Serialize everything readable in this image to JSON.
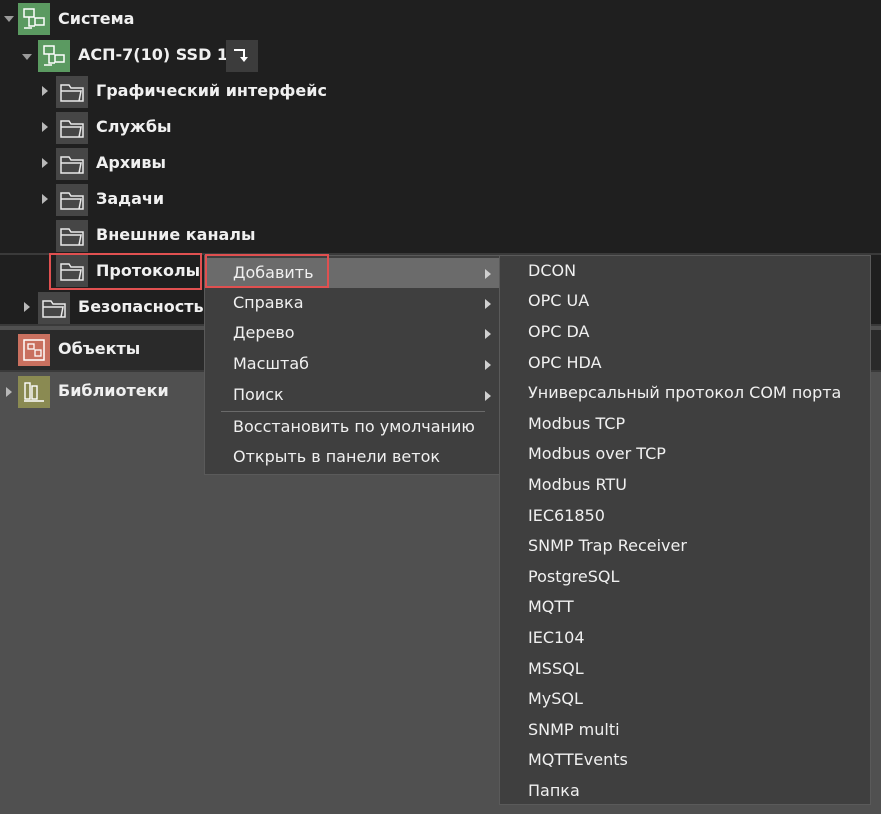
{
  "tree": {
    "root": "Система",
    "device": "АСП-7(10) SSD 1",
    "children": [
      "Графический интерфейс",
      "Службы",
      "Архивы",
      "Задачи",
      "Внешние каналы",
      "Протоколы"
    ],
    "security": "Безопасность"
  },
  "panels": {
    "objects": "Объекты",
    "libraries": "Библиотеки"
  },
  "context_menu": {
    "items": [
      "Добавить",
      "Справка",
      "Дерево",
      "Масштаб",
      "Поиск"
    ],
    "extra": [
      "Восстановить по умолчанию",
      "Открыть в панели веток"
    ]
  },
  "submenu": {
    "items": [
      "DCON",
      "OPC UA",
      "OPC DA",
      "OPC HDA",
      "Универсальный протокол COM порта",
      "Modbus TCP",
      "Modbus over TCP",
      "Modbus RTU",
      "IEC61850",
      "SNMP Trap Receiver",
      "PostgreSQL",
      "MQTT",
      "IEC104",
      "MSSQL",
      "MySQL",
      "SNMP multi",
      "MQTTEvents",
      "Папка"
    ]
  },
  "colors": {
    "highlight": "#e05050",
    "system_icon": "#5b9a61",
    "objects_icon": "#c9705f",
    "libraries_icon": "#8a8a52"
  }
}
